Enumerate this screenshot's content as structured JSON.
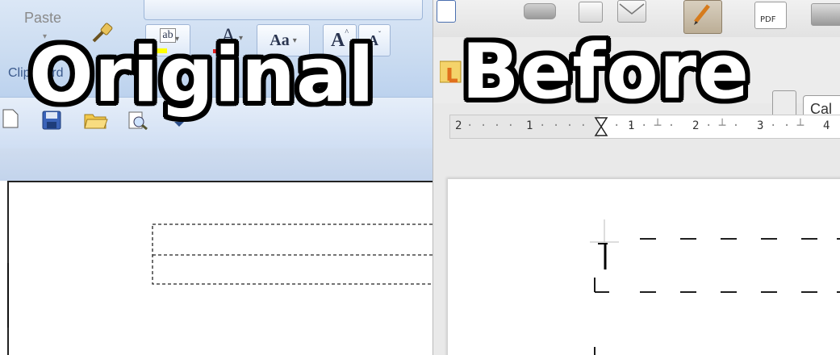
{
  "overlay": {
    "left_title": "Original",
    "right_title": "Before"
  },
  "left_app": {
    "ribbon": {
      "paste_label": "Paste",
      "clipboard_label": "Clipboard",
      "font_size_aa": "Aa",
      "grow_font": "A",
      "shrink_font": "A",
      "font_color_letter": "A",
      "highlight_label": "ab"
    },
    "colors": {
      "ribbon_top": "#dbe7f6",
      "font_color_bar": "#e02020",
      "highlight_bar": "#ffff00"
    }
  },
  "right_app": {
    "ruler_numbers": [
      "2",
      "1",
      "1",
      "2",
      "3",
      "4"
    ],
    "font_name_visible": "Cal",
    "pdf_label": "PDF",
    "colors": {
      "toolbar_bg": "#ececec",
      "ruler_grey": "#e6e6e6"
    }
  }
}
